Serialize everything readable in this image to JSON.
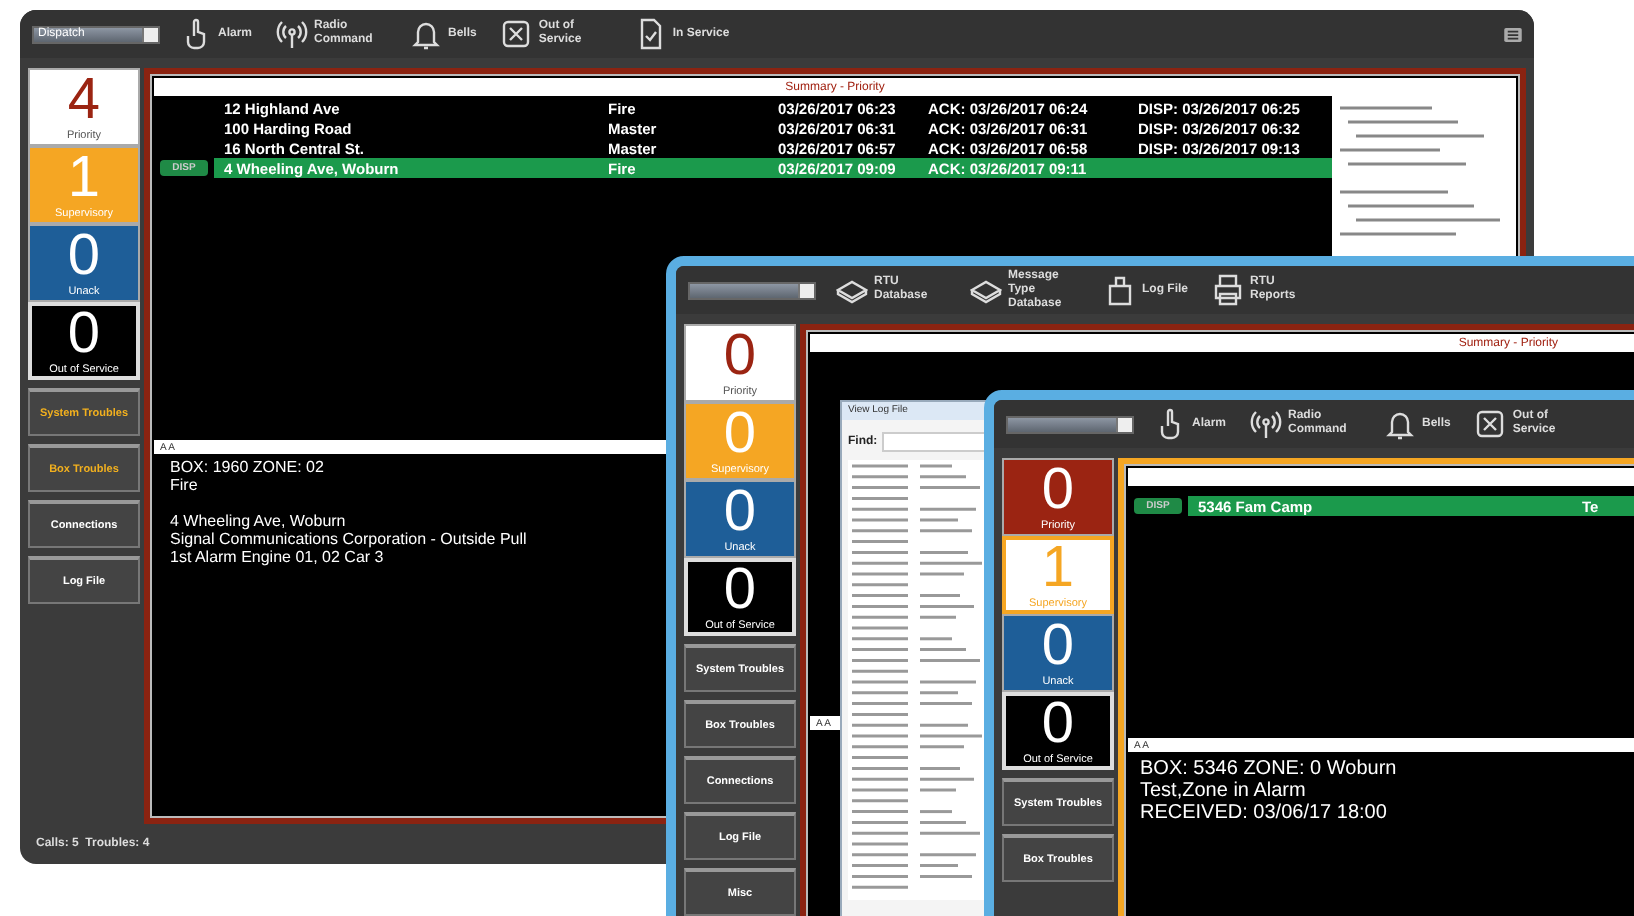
{
  "windows": [
    {
      "kind": "main",
      "toolbar": {
        "dropdown": "Dispatch",
        "menu": true,
        "buttons": [
          {
            "kind": "alarm",
            "label": "Alarm"
          },
          {
            "kind": "radio",
            "label": "Radio Command"
          },
          {
            "kind": "bell",
            "label": "Bells"
          },
          {
            "kind": "out",
            "label": "Out of Service"
          },
          {
            "kind": "in",
            "label": "In Service"
          }
        ]
      },
      "tiles": [
        {
          "kind": "light",
          "count": "4",
          "label": "Priority"
        },
        {
          "kind": "amber",
          "count": "1",
          "label": "Supervisory"
        },
        {
          "kind": "blue",
          "count": "0",
          "label": "Unack"
        },
        {
          "kind": "dark",
          "count": "0",
          "label": "Out of Service"
        }
      ],
      "side_buttons": [
        {
          "label": "System Troubles",
          "alert": true
        },
        {
          "label": "Box Troubles",
          "alert": true
        },
        {
          "label": "Connections",
          "alert": false
        },
        {
          "label": "Log File",
          "alert": false
        }
      ],
      "summary_title": "Summary - Priority",
      "rows": [
        {
          "address": "12 Highland Ave",
          "type": "Fire",
          "time": "03/26/2017 06:23",
          "ack": "ACK: 03/26/2017 06:24",
          "disp": "DISP: 03/26/2017 06:25",
          "selected": false
        },
        {
          "address": "100 Harding Road",
          "type": "Master",
          "time": "03/26/2017 06:31",
          "ack": "ACK: 03/26/2017 06:31",
          "disp": "DISP: 03/26/2017 06:32",
          "selected": false
        },
        {
          "address": "16 North Central St.",
          "type": "Master",
          "time": "03/26/2017 06:57",
          "ack": "ACK: 03/26/2017 06:58",
          "disp": "DISP: 03/26/2017 09:13",
          "selected": false
        },
        {
          "badge": "DISP",
          "address": "4 Wheeling Ave, Woburn",
          "type": "Fire",
          "time": "03/26/2017 09:09",
          "ack": "ACK: 03/26/2017 09:11",
          "selected": true
        }
      ],
      "detail_header": "A A",
      "detail_blocks": [
        [
          "BOX: 1960    ZONE: 02",
          "Fire"
        ],
        [
          "4 Wheeling Ave, Woburn",
          "Signal Communications Corporation - Outside Pull",
          "1st Alarm Engine 01, 02 Car 3"
        ]
      ],
      "status": "Calls: 5  Troubles: 4"
    },
    {
      "kind": "config",
      "toolbar": {
        "buttons": [
          {
            "kind": "tray",
            "label": "RTU Database"
          },
          {
            "kind": "tray",
            "label": "Message Type Database"
          },
          {
            "kind": "log",
            "label": "Log File"
          },
          {
            "kind": "printer",
            "label": "RTU Reports"
          }
        ]
      },
      "tiles": [
        {
          "kind": "light",
          "count": "0",
          "label": "Priority"
        },
        {
          "kind": "amber",
          "count": "0",
          "label": "Supervisory"
        },
        {
          "kind": "blue",
          "count": "0",
          "label": "Unack"
        },
        {
          "kind": "dark",
          "count": "0",
          "label": "Out of Service"
        }
      ],
      "side_buttons": [
        {
          "label": "System Troubles",
          "alert": false
        },
        {
          "label": "Box Troubles",
          "alert": false
        },
        {
          "label": "Connections",
          "alert": false
        },
        {
          "label": "Log File",
          "alert": false
        },
        {
          "label": "Misc",
          "alert": false
        }
      ],
      "summary_title": "Summary - Priority",
      "detail_header": "A A",
      "dialog": {
        "title": "View Log File",
        "find_label": "Find:"
      }
    },
    {
      "kind": "alarm",
      "toolbar": {
        "buttons": [
          {
            "kind": "alarm",
            "label": "Alarm"
          },
          {
            "kind": "radio",
            "label": "Radio Command"
          },
          {
            "kind": "bell",
            "label": "Bells"
          },
          {
            "kind": "out",
            "label": "Out of Service"
          }
        ]
      },
      "tiles": [
        {
          "kind": "red",
          "count": "0",
          "label": "Priority"
        },
        {
          "kind": "light-amber",
          "count": "1",
          "label": "Supervisory"
        },
        {
          "kind": "blue",
          "count": "0",
          "label": "Unack"
        },
        {
          "kind": "dark",
          "count": "0",
          "label": "Out of Service"
        }
      ],
      "side_buttons": [
        {
          "label": "System Troubles",
          "alert": false
        },
        {
          "label": "Box Troubles",
          "alert": false
        }
      ],
      "rows": [
        {
          "badge": "DISP",
          "address": "5346 Fam Camp",
          "type": "Te",
          "selected": true
        }
      ],
      "detail_header": "A A",
      "detail_blocks": [
        [
          "BOX: 5346    ZONE: 0    Woburn",
          "Test,Zone in Alarm",
          "RECEIVED: 03/06/17 18:00"
        ]
      ]
    }
  ]
}
